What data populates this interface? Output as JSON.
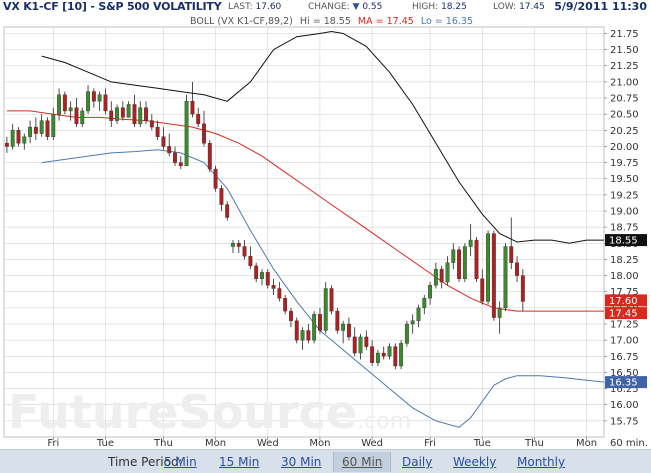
{
  "header": {
    "title": "VX K1-CF [10] - S&P 500 VOLATILITY",
    "last_label": "LAST:",
    "last_value": "17.60",
    "change_label": "CHANGE:",
    "change_value": "0.55",
    "high_label": "HIGH:",
    "high_value": "18.25",
    "low_label": "LOW:",
    "low_value": "17.45",
    "datetime": "5/9/2011 11:30"
  },
  "legend": {
    "name": "BOLL (VX K1-CF,89,2)",
    "hi_label": "Hi = ",
    "hi_value": "18.55",
    "ma_label": "MA = ",
    "ma_value": "17.45",
    "lo_label": "Lo = ",
    "lo_value": "16.35"
  },
  "watermark": {
    "main": "FutureSource",
    "suffix": ".com"
  },
  "footer": {
    "label": "Time Period:",
    "periods": [
      {
        "label": "5 Min",
        "selected": false
      },
      {
        "label": "15 Min",
        "selected": false
      },
      {
        "label": "30 Min",
        "selected": false
      },
      {
        "label": "60 Min",
        "selected": true
      },
      {
        "label": "Daily",
        "selected": false
      },
      {
        "label": "Weekly",
        "selected": false
      },
      {
        "label": "Monthly",
        "selected": false
      }
    ]
  },
  "colors": {
    "up_candle": "#3d8a2d",
    "down_candle": "#b02020",
    "wick": "#222222",
    "upper_band": "#111111",
    "middle_band": "#d9291e",
    "lower_band": "#4f79b0",
    "grid": "#cccccc",
    "hi_tag": "#111111",
    "ma_tag": "#d9291e",
    "lo_tag": "#3f63a6",
    "last_tag": "#d9291e"
  },
  "chart_data": {
    "type": "candlestick",
    "x_axis_unit_label": "60 min.",
    "x_ticks": [
      {
        "label": "Fri",
        "t": 8
      },
      {
        "label": "Tue",
        "t": 17
      },
      {
        "label": "Thu",
        "t": 27
      },
      {
        "label": "Mon",
        "t": 36
      },
      {
        "label": "Wed",
        "t": 45
      },
      {
        "label": "Mon",
        "t": 54
      },
      {
        "label": "Wed",
        "t": 63
      },
      {
        "label": "Fri",
        "t": 73
      },
      {
        "label": "Tue",
        "t": 82
      },
      {
        "label": "Thu",
        "t": 91
      },
      {
        "label": "Mon",
        "t": 100
      }
    ],
    "ylim": [
      15.5,
      21.85
    ],
    "y_ticks": [
      "15.75",
      "16.00",
      "16.25",
      "16.50",
      "16.75",
      "17.00",
      "17.25",
      "17.50",
      "17.75",
      "18.00",
      "18.25",
      "18.50",
      "18.75",
      "19.00",
      "19.25",
      "19.50",
      "19.75",
      "20.00",
      "20.25",
      "20.50",
      "20.75",
      "21.00",
      "21.25",
      "21.50",
      "21.75"
    ],
    "price_tags": [
      {
        "kind": "hi",
        "value": 18.55,
        "label": "18.55"
      },
      {
        "kind": "last",
        "value": 17.6,
        "label": "17.60"
      },
      {
        "kind": "ma",
        "value": 17.45,
        "label": "17.45"
      },
      {
        "kind": "lo",
        "value": 16.35,
        "label": "16.35"
      }
    ],
    "candles": [
      [
        20.05,
        20.15,
        19.9,
        20.0
      ],
      [
        20.0,
        20.35,
        19.95,
        20.25
      ],
      [
        20.25,
        20.3,
        20.0,
        20.05
      ],
      [
        20.05,
        20.2,
        19.95,
        20.15
      ],
      [
        20.15,
        20.4,
        20.05,
        20.3
      ],
      [
        20.3,
        20.45,
        20.1,
        20.2
      ],
      [
        20.2,
        20.5,
        20.15,
        20.4
      ],
      [
        20.4,
        20.45,
        20.1,
        20.15
      ],
      [
        20.15,
        20.6,
        20.1,
        20.5
      ],
      [
        20.5,
        20.9,
        20.4,
        20.8
      ],
      [
        20.8,
        20.85,
        20.5,
        20.55
      ],
      [
        20.55,
        20.7,
        20.4,
        20.6
      ],
      [
        20.6,
        20.75,
        20.3,
        20.35
      ],
      [
        20.35,
        20.6,
        20.3,
        20.55
      ],
      [
        20.55,
        20.95,
        20.5,
        20.85
      ],
      [
        20.85,
        20.9,
        20.6,
        20.7
      ],
      [
        20.7,
        20.85,
        20.55,
        20.8
      ],
      [
        20.8,
        20.9,
        20.5,
        20.55
      ],
      [
        20.55,
        20.7,
        20.3,
        20.4
      ],
      [
        20.4,
        20.65,
        20.35,
        20.6
      ],
      [
        20.6,
        20.7,
        20.4,
        20.45
      ],
      [
        20.45,
        20.7,
        20.45,
        20.65
      ],
      [
        20.65,
        20.8,
        20.3,
        20.35
      ],
      [
        20.35,
        20.7,
        20.3,
        20.6
      ],
      [
        20.6,
        20.7,
        20.35,
        20.4
      ],
      [
        20.4,
        20.5,
        20.25,
        20.3
      ],
      [
        20.3,
        20.4,
        20.1,
        20.15
      ],
      [
        20.15,
        20.3,
        19.95,
        20.0
      ],
      [
        20.0,
        20.2,
        19.85,
        19.9
      ],
      [
        19.9,
        20.0,
        19.7,
        19.75
      ],
      [
        19.75,
        19.85,
        19.65,
        19.7
      ],
      [
        19.7,
        20.8,
        19.7,
        20.7
      ],
      [
        20.7,
        21.0,
        20.45,
        20.5
      ],
      [
        20.5,
        20.6,
        20.3,
        20.35
      ],
      [
        20.35,
        20.55,
        20.0,
        20.05
      ],
      [
        20.05,
        20.1,
        19.6,
        19.65
      ],
      [
        19.65,
        19.7,
        19.3,
        19.35
      ],
      [
        19.35,
        19.4,
        19.0,
        19.1
      ],
      [
        19.1,
        19.15,
        18.85,
        18.9
      ],
      [
        18.45,
        18.55,
        18.35,
        18.5
      ],
      [
        18.5,
        18.55,
        18.35,
        18.45
      ],
      [
        18.45,
        18.55,
        18.25,
        18.3
      ],
      [
        18.3,
        18.45,
        18.1,
        18.15
      ],
      [
        18.15,
        18.2,
        17.9,
        17.95
      ],
      [
        17.95,
        18.1,
        17.85,
        18.05
      ],
      [
        18.05,
        18.1,
        17.8,
        17.85
      ],
      [
        17.85,
        17.95,
        17.7,
        17.8
      ],
      [
        17.8,
        17.9,
        17.6,
        17.65
      ],
      [
        17.65,
        17.7,
        17.4,
        17.45
      ],
      [
        17.45,
        17.5,
        17.2,
        17.3
      ],
      [
        17.3,
        17.35,
        16.95,
        17.0
      ],
      [
        17.0,
        17.2,
        16.85,
        17.15
      ],
      [
        17.15,
        17.25,
        16.95,
        17.0
      ],
      [
        17.0,
        17.45,
        16.95,
        17.4
      ],
      [
        17.4,
        17.5,
        17.1,
        17.15
      ],
      [
        17.15,
        17.9,
        17.1,
        17.8
      ],
      [
        17.8,
        17.85,
        17.4,
        17.45
      ],
      [
        17.45,
        17.5,
        17.1,
        17.15
      ],
      [
        17.15,
        17.3,
        16.95,
        17.25
      ],
      [
        17.25,
        17.35,
        17.0,
        17.05
      ],
      [
        17.05,
        17.2,
        16.75,
        16.8
      ],
      [
        16.8,
        17.1,
        16.7,
        17.05
      ],
      [
        17.05,
        17.15,
        16.85,
        16.9
      ],
      [
        16.9,
        17.0,
        16.6,
        16.65
      ],
      [
        16.65,
        16.85,
        16.6,
        16.8
      ],
      [
        16.8,
        16.9,
        16.7,
        16.75
      ],
      [
        16.75,
        16.95,
        16.7,
        16.9
      ],
      [
        16.9,
        16.95,
        16.55,
        16.6
      ],
      [
        16.6,
        17.0,
        16.55,
        16.95
      ],
      [
        16.95,
        17.3,
        16.9,
        17.25
      ],
      [
        17.25,
        17.4,
        17.1,
        17.3
      ],
      [
        17.3,
        17.55,
        17.2,
        17.5
      ],
      [
        17.5,
        17.7,
        17.4,
        17.65
      ],
      [
        17.65,
        17.9,
        17.55,
        17.85
      ],
      [
        17.85,
        18.2,
        17.8,
        18.1
      ],
      [
        18.1,
        18.15,
        17.8,
        17.9
      ],
      [
        17.9,
        18.3,
        17.85,
        18.2
      ],
      [
        18.2,
        18.5,
        18.1,
        18.4
      ],
      [
        18.4,
        18.45,
        17.9,
        17.95
      ],
      [
        17.95,
        18.5,
        17.9,
        18.45
      ],
      [
        18.45,
        18.8,
        18.3,
        18.55
      ],
      [
        18.55,
        18.6,
        17.9,
        17.95
      ],
      [
        17.95,
        18.1,
        17.55,
        17.6
      ],
      [
        17.6,
        18.7,
        17.55,
        18.65
      ],
      [
        18.65,
        18.7,
        17.3,
        17.35
      ],
      [
        17.35,
        17.6,
        17.1,
        17.5
      ],
      [
        17.5,
        18.5,
        17.45,
        18.45
      ],
      [
        18.45,
        18.9,
        18.1,
        18.2
      ],
      [
        18.2,
        18.3,
        17.9,
        18.0
      ],
      [
        18.0,
        18.1,
        17.45,
        17.6
      ]
    ],
    "bands": {
      "upper": [
        [
          6,
          21.4
        ],
        [
          10,
          21.3
        ],
        [
          14,
          21.15
        ],
        [
          18,
          21.0
        ],
        [
          22,
          20.95
        ],
        [
          26,
          20.9
        ],
        [
          30,
          20.85
        ],
        [
          34,
          20.8
        ],
        [
          38,
          20.7
        ],
        [
          42,
          21.0
        ],
        [
          46,
          21.5
        ],
        [
          50,
          21.7
        ],
        [
          54,
          21.75
        ],
        [
          56,
          21.78
        ],
        [
          58,
          21.75
        ],
        [
          62,
          21.55
        ],
        [
          66,
          21.15
        ],
        [
          70,
          20.65
        ],
        [
          74,
          20.05
        ],
        [
          78,
          19.45
        ],
        [
          82,
          18.95
        ],
        [
          85,
          18.65
        ],
        [
          88,
          18.52
        ],
        [
          91,
          18.55
        ],
        [
          94,
          18.55
        ],
        [
          97,
          18.5
        ],
        [
          100,
          18.55
        ],
        [
          103,
          18.55
        ]
      ],
      "middle": [
        [
          0,
          20.55
        ],
        [
          4,
          20.55
        ],
        [
          8,
          20.5
        ],
        [
          12,
          20.45
        ],
        [
          16,
          20.45
        ],
        [
          20,
          20.42
        ],
        [
          24,
          20.4
        ],
        [
          28,
          20.35
        ],
        [
          32,
          20.3
        ],
        [
          36,
          20.2
        ],
        [
          40,
          20.05
        ],
        [
          44,
          19.85
        ],
        [
          48,
          19.6
        ],
        [
          52,
          19.35
        ],
        [
          56,
          19.1
        ],
        [
          60,
          18.85
        ],
        [
          64,
          18.6
        ],
        [
          68,
          18.35
        ],
        [
          72,
          18.1
        ],
        [
          76,
          17.85
        ],
        [
          80,
          17.65
        ],
        [
          84,
          17.5
        ],
        [
          88,
          17.45
        ],
        [
          92,
          17.45
        ],
        [
          96,
          17.45
        ],
        [
          100,
          17.45
        ],
        [
          103,
          17.45
        ]
      ],
      "lower": [
        [
          6,
          19.75
        ],
        [
          10,
          19.8
        ],
        [
          14,
          19.85
        ],
        [
          18,
          19.9
        ],
        [
          22,
          19.92
        ],
        [
          26,
          19.95
        ],
        [
          30,
          19.9
        ],
        [
          34,
          19.75
        ],
        [
          38,
          19.35
        ],
        [
          42,
          18.7
        ],
        [
          46,
          18.1
        ],
        [
          50,
          17.6
        ],
        [
          54,
          17.15
        ],
        [
          58,
          16.85
        ],
        [
          62,
          16.55
        ],
        [
          66,
          16.25
        ],
        [
          70,
          15.95
        ],
        [
          74,
          15.75
        ],
        [
          78,
          15.65
        ],
        [
          80,
          15.8
        ],
        [
          82,
          16.05
        ],
        [
          84,
          16.3
        ],
        [
          86,
          16.4
        ],
        [
          88,
          16.45
        ],
        [
          92,
          16.45
        ],
        [
          96,
          16.42
        ],
        [
          100,
          16.38
        ],
        [
          103,
          16.35
        ]
      ]
    }
  }
}
